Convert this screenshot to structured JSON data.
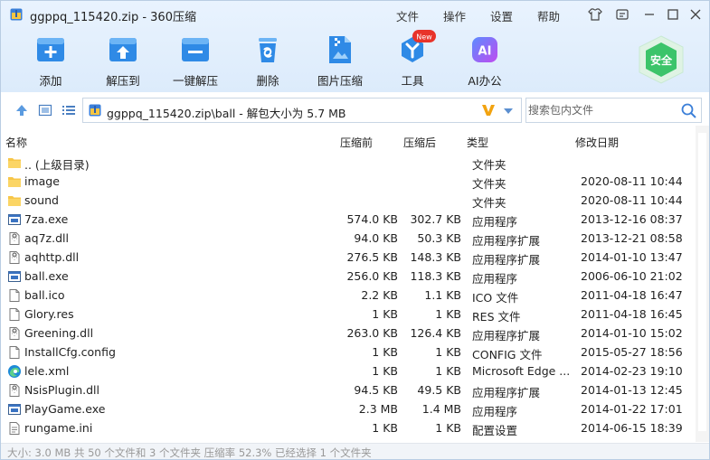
{
  "window": {
    "title": "ggppq_115420.zip - 360压缩",
    "menu": [
      "文件",
      "操作",
      "设置",
      "帮助"
    ]
  },
  "toolbar": {
    "items": [
      {
        "label": "添加",
        "icon": "add-icon"
      },
      {
        "label": "解压到",
        "icon": "extract-to-icon"
      },
      {
        "label": "一键解压",
        "icon": "one-click-extract-icon"
      },
      {
        "label": "删除",
        "icon": "delete-icon"
      },
      {
        "label": "图片压缩",
        "icon": "image-compress-icon"
      },
      {
        "label": "工具",
        "icon": "tools-icon",
        "badge": "New"
      },
      {
        "label": "AI办公",
        "icon": "ai-office-icon",
        "glyph": "AI"
      }
    ],
    "safe_badge": "安全"
  },
  "address": {
    "path": "ggppq_115420.zip\\ball - 解包大小为 5.7 MB",
    "search_placeholder": "搜索包内文件"
  },
  "list": {
    "columns": {
      "name": "名称",
      "size": "压缩前",
      "packed": "压缩后",
      "type": "类型",
      "modified": "修改日期"
    },
    "rows": [
      {
        "name": ".. (上级目录)",
        "size": "",
        "packed": "",
        "type": "文件夹",
        "modified": "",
        "icon": "folder"
      },
      {
        "name": "image",
        "size": "",
        "packed": "",
        "type": "文件夹",
        "modified": "2020-08-11 10:44",
        "icon": "folder"
      },
      {
        "name": "sound",
        "size": "",
        "packed": "",
        "type": "文件夹",
        "modified": "2020-08-11 10:44",
        "icon": "folder"
      },
      {
        "name": "7za.exe",
        "size": "574.0 KB",
        "packed": "302.7 KB",
        "type": "应用程序",
        "modified": "2013-12-16 08:37",
        "icon": "exe"
      },
      {
        "name": "aq7z.dll",
        "size": "94.0 KB",
        "packed": "50.3 KB",
        "type": "应用程序扩展",
        "modified": "2013-12-21 08:58",
        "icon": "dll"
      },
      {
        "name": "aqhttp.dll",
        "size": "276.5 KB",
        "packed": "148.3 KB",
        "type": "应用程序扩展",
        "modified": "2014-01-10 13:47",
        "icon": "dll"
      },
      {
        "name": "ball.exe",
        "size": "256.0 KB",
        "packed": "118.3 KB",
        "type": "应用程序",
        "modified": "2006-06-10 21:02",
        "icon": "exe"
      },
      {
        "name": "ball.ico",
        "size": "2.2 KB",
        "packed": "1.1 KB",
        "type": "ICO 文件",
        "modified": "2011-04-18 16:47",
        "icon": "file"
      },
      {
        "name": "Glory.res",
        "size": "1 KB",
        "packed": "1 KB",
        "type": "RES 文件",
        "modified": "2011-04-18 16:45",
        "icon": "file"
      },
      {
        "name": "Greening.dll",
        "size": "263.0 KB",
        "packed": "126.4 KB",
        "type": "应用程序扩展",
        "modified": "2014-01-10 15:02",
        "icon": "dll"
      },
      {
        "name": "InstallCfg.config",
        "size": "1 KB",
        "packed": "1 KB",
        "type": "CONFIG 文件",
        "modified": "2015-05-27 18:56",
        "icon": "file"
      },
      {
        "name": "lele.xml",
        "size": "1 KB",
        "packed": "1 KB",
        "type": "Microsoft Edge ...",
        "modified": "2014-02-23 19:10",
        "icon": "edge"
      },
      {
        "name": "NsisPlugin.dll",
        "size": "94.5 KB",
        "packed": "49.5 KB",
        "type": "应用程序扩展",
        "modified": "2014-01-13 12:45",
        "icon": "dll"
      },
      {
        "name": "PlayGame.exe",
        "size": "2.3 MB",
        "packed": "1.4 MB",
        "type": "应用程序",
        "modified": "2014-01-22 17:01",
        "icon": "exe"
      },
      {
        "name": "rungame.ini",
        "size": "1 KB",
        "packed": "1 KB",
        "type": "配置设置",
        "modified": "2014-06-15 18:39",
        "icon": "ini"
      }
    ]
  },
  "status": {
    "text": "大小: 3.0 MB 共 50 个文件和 3 个文件夹 压缩率 52.3% 已经选择 1 个文件夹"
  },
  "colors": {
    "accent": "#1e88e5",
    "toolbar_bg": "#e4effc",
    "safe_green": "#3cc46a",
    "folder": "#f7c648",
    "new_badge": "#e8332a"
  }
}
